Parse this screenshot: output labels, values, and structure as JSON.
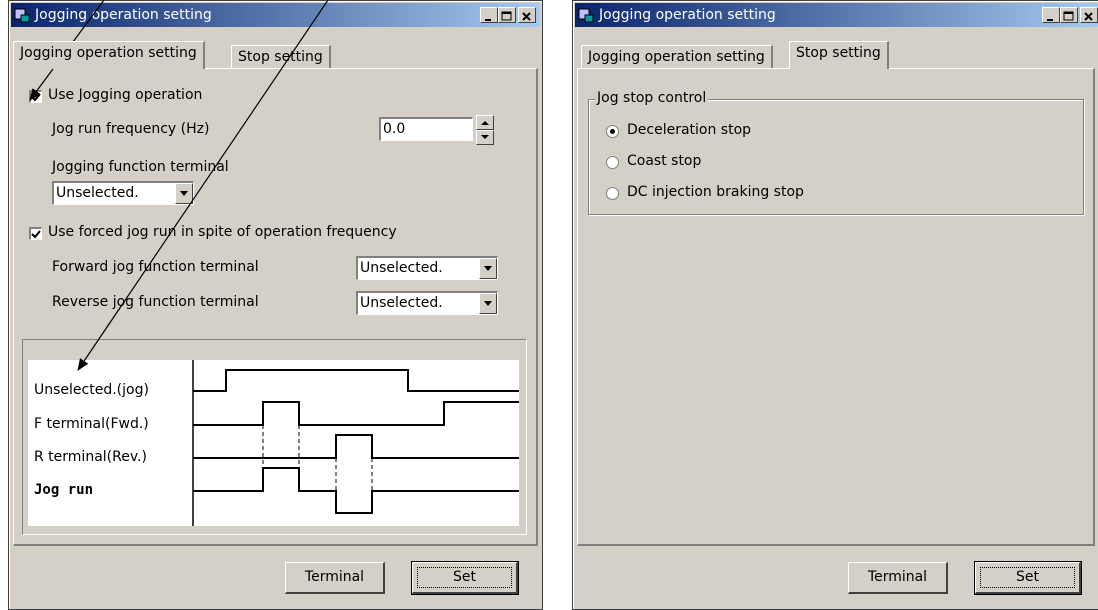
{
  "left_window": {
    "title": "Jogging operation setting",
    "tabs": [
      "Jogging operation setting",
      "Stop setting"
    ],
    "use_jogging_label": "Use Jogging operation",
    "use_jogging_checked": true,
    "jog_freq_label": "Jog run frequency (Hz)",
    "jog_freq_value": "0.0",
    "jog_terminal_label": "Jogging function terminal",
    "jog_terminal_value": "Unselected.",
    "forced_jog_label": "Use forced jog run in spite of operation frequency",
    "forced_jog_checked": true,
    "fwd_terminal_label": "Forward jog function terminal",
    "fwd_terminal_value": "Unselected.",
    "rev_terminal_label": "Reverse jog function terminal",
    "rev_terminal_value": "Unselected.",
    "diagram_labels": [
      "Unselected.(jog)",
      "F terminal(Fwd.)",
      "R terminal(Rev.)",
      "Jog run"
    ],
    "terminal_button": "Terminal",
    "set_button": "Set"
  },
  "right_window": {
    "title": "Jogging operation setting",
    "tabs": [
      "Jogging operation setting",
      "Stop setting"
    ],
    "group_title": "Jog stop control",
    "options": [
      "Deceleration stop",
      "Coast stop",
      "DC injection braking stop"
    ],
    "selected_option": "Deceleration stop",
    "terminal_button": "Terminal",
    "set_button": "Set"
  },
  "colors": {
    "title_start": "#0a246a",
    "title_end": "#a6caf0",
    "dialog_face": "#d4d0c8"
  },
  "icons": [
    "app-icon",
    "minimize-icon",
    "maximize-icon",
    "close-icon",
    "check-icon",
    "chevron-down-icon",
    "spin-up-icon",
    "spin-down-icon",
    "annotation-arrow-icon"
  ]
}
